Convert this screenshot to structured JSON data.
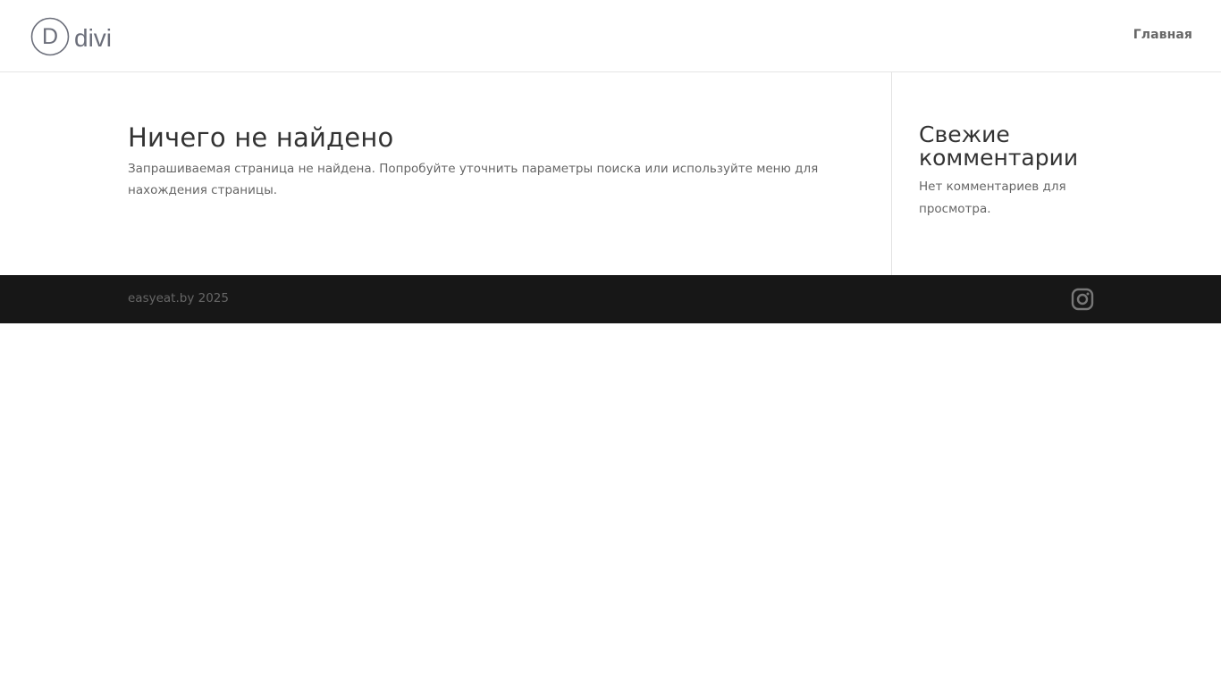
{
  "header": {
    "logo_text": "divi",
    "logo_letter": "D",
    "nav": {
      "home_label": "Главная"
    }
  },
  "main": {
    "title": "Ничего не найдено",
    "text": "Запрашиваемая страница не найдена. Попробуйте уточнить параметры поиска или используйте меню для нахождения страницы."
  },
  "sidebar": {
    "title": "Свежие комментарии",
    "text": "Нет комментариев для просмотра."
  },
  "footer": {
    "credit": "easyeat.by 2025",
    "social_icon": "instagram-icon"
  },
  "colors": {
    "text_dark": "#333333",
    "text_muted": "#666666",
    "footer_bg": "#171717",
    "logo": "#6b6e7a"
  }
}
